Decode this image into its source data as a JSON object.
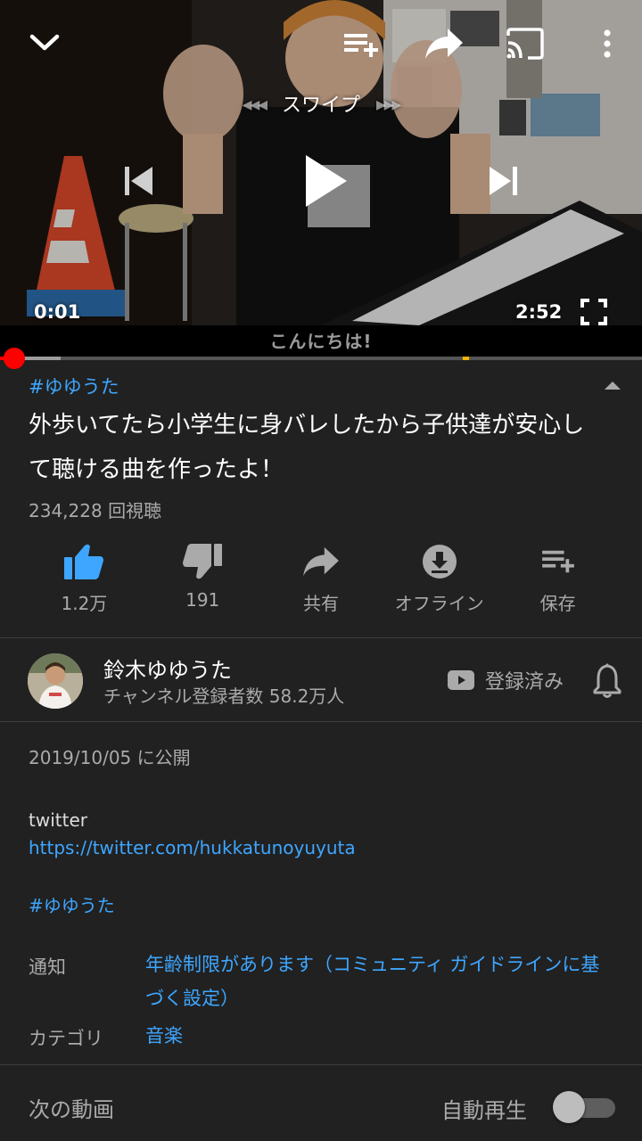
{
  "player": {
    "swipe_label": "スワイプ",
    "current_time": "0:01",
    "duration": "2:52",
    "subtitle_text": "こんにちは!",
    "progress_fraction": 0.0058
  },
  "video": {
    "hashtag": "#ゆゆうた",
    "title": "外歩いてたら小学生に身バレしたから子供達が安心して聴ける曲を作ったよ！",
    "views": "234,228 回視聴"
  },
  "actions": [
    {
      "icon": "thumbs-up-icon",
      "label": "1.2万",
      "active": true
    },
    {
      "icon": "thumbs-down-icon",
      "label": "191",
      "active": false
    },
    {
      "icon": "share-icon",
      "label": "共有",
      "active": false
    },
    {
      "icon": "download-icon",
      "label": "オフライン",
      "active": false
    },
    {
      "icon": "playlist-add-icon",
      "label": "保存",
      "active": false
    }
  ],
  "channel": {
    "name": "鈴木ゆゆうた",
    "subscribers": "チャンネル登録者数 58.2万人",
    "subscribed_label": "登録済み"
  },
  "description": {
    "published": "2019/10/05 に公開",
    "twitter_label": "twitter",
    "twitter_url": "https://twitter.com/hukkatunoyuyuta",
    "hashtag": "#ゆゆうた",
    "notice_key": "通知",
    "notice_value": "年齢制限があります（コミュニティ ガイドラインに基づく設定）",
    "category_key": "カテゴリ",
    "category_value": "音楽"
  },
  "up_next": {
    "label": "次の動画",
    "autoplay_label": "自動再生",
    "autoplay_on": false
  },
  "colors": {
    "background": "#212121",
    "link": "#3ea6ff",
    "accent_red": "#ff0000",
    "like_active": "#3ea6ff"
  }
}
